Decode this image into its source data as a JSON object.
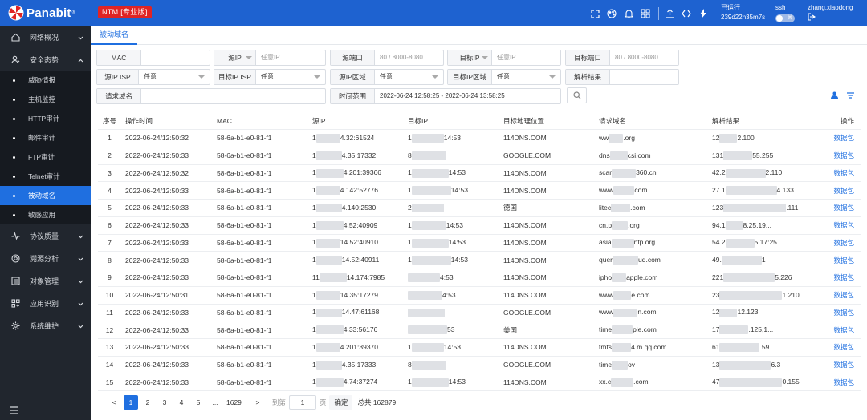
{
  "header": {
    "brand": "Panabit",
    "brand_reg": "®",
    "product_tag": "NTM [专业版]",
    "uptime_label": "已运行",
    "uptime_value": "239d22h35m7s",
    "ssh_label": "ssh",
    "ssh_toggle": "关",
    "username": "zhang.xiaodong",
    "icons": [
      "fullscreen-icon",
      "theme-icon",
      "bell-icon",
      "grid-icon",
      "upload-icon",
      "code-icon",
      "lightning-icon",
      "logout-icon"
    ]
  },
  "sidebar": {
    "items": [
      {
        "label": "网络概况",
        "icon": "home-icon",
        "expanded": false
      },
      {
        "label": "安全态势",
        "icon": "user-shield-icon",
        "expanded": true
      }
    ],
    "sub_items": [
      {
        "label": "威胁情报",
        "active": false
      },
      {
        "label": "主机监控",
        "active": false
      },
      {
        "label": "HTTP审计",
        "active": false
      },
      {
        "label": "邮件审计",
        "active": false
      },
      {
        "label": "FTP审计",
        "active": false
      },
      {
        "label": "Telnet审计",
        "active": false
      },
      {
        "label": "被动域名",
        "active": true
      },
      {
        "label": "敏感应用",
        "active": false
      }
    ],
    "items_after": [
      {
        "label": "协议质量",
        "icon": "pulse-icon"
      },
      {
        "label": "溯源分析",
        "icon": "radar-icon"
      },
      {
        "label": "对象管理",
        "icon": "list-icon"
      },
      {
        "label": "应用识别",
        "icon": "apps-icon"
      },
      {
        "label": "系统维护",
        "icon": "gear-icon"
      }
    ]
  },
  "tab": {
    "label": "被动域名"
  },
  "filters": {
    "mac": {
      "label": "MAC",
      "value": ""
    },
    "src_ip_type": {
      "label": "源IP",
      "placeholder": "任意IP"
    },
    "src_port": {
      "label": "源端口",
      "placeholder": "80 / 8000-8080"
    },
    "dst_ip_type": {
      "label": "目标IP",
      "placeholder": "任意IP"
    },
    "dst_port": {
      "label": "目标端口",
      "placeholder": "80 / 8000-8080"
    },
    "src_isp": {
      "label": "源IP ISP",
      "value": "任意"
    },
    "dst_isp": {
      "label": "目标IP ISP",
      "value": "任意"
    },
    "src_region": {
      "label": "源IP区域",
      "value": "任意"
    },
    "dst_region": {
      "label": "目标IP区域",
      "value": "任意"
    },
    "resolve_result": {
      "label": "解析结果",
      "value": ""
    },
    "domain": {
      "label": "请求域名",
      "value": ""
    },
    "time_range": {
      "label": "时间范围",
      "value": "2022-06-24 12:58:25 - 2022-06-24 13:58:25"
    }
  },
  "table": {
    "columns": [
      "序号",
      "操作时间",
      "MAC",
      "源IP",
      "目标IP",
      "目标地理位置",
      "请求域名",
      "解析结果",
      "操作"
    ],
    "rows": [
      {
        "no": "1",
        "time": "2022-06-24/12:50:32",
        "mac": "58-6a-b1-e0-81-f1",
        "src_a": "1",
        "src_b": "4.32:61524",
        "dst_a": "1",
        "dst_b": "14:53",
        "geo": "114DNS.COM",
        "dom_a": "ww",
        "dom_b": ".org",
        "res_a": "12",
        "res_b": "2.100",
        "op": "数据包"
      },
      {
        "no": "2",
        "time": "2022-06-24/12:50:33",
        "mac": "58-6a-b1-e0-81-f1",
        "src_a": "1",
        "src_b": "4.35:17332",
        "dst_a": "8",
        "dst_b": "",
        "geo": "GOOGLE.COM",
        "dom_a": "dns",
        "dom_b": "csi.com",
        "res_a": "131",
        "res_b": "55.255",
        "op": "数据包"
      },
      {
        "no": "3",
        "time": "2022-06-24/12:50:32",
        "mac": "58-6a-b1-e0-81-f1",
        "src_a": "1",
        "src_b": "4.201:39366",
        "dst_a": "1",
        "dst_b": "14:53",
        "geo": "114DNS.COM",
        "dom_a": "scar",
        "dom_b": "360.cn",
        "res_a": "42.2",
        "res_b": "2.110",
        "op": "数据包"
      },
      {
        "no": "4",
        "time": "2022-06-24/12:50:33",
        "mac": "58-6a-b1-e0-81-f1",
        "src_a": "1",
        "src_b": "4.142:52776",
        "dst_a": "1",
        "dst_b": "14:53",
        "geo": "114DNS.COM",
        "dom_a": "www",
        "dom_b": "com",
        "res_a": "27.1",
        "res_b": "4.133",
        "op": "数据包"
      },
      {
        "no": "5",
        "time": "2022-06-24/12:50:33",
        "mac": "58-6a-b1-e0-81-f1",
        "src_a": "1",
        "src_b": "4.140:2530",
        "dst_a": "2",
        "dst_b": "",
        "geo": "德国",
        "dom_a": "litec",
        "dom_b": ".com",
        "res_a": "123",
        "res_b": ".111",
        "op": "数据包"
      },
      {
        "no": "6",
        "time": "2022-06-24/12:50:33",
        "mac": "58-6a-b1-e0-81-f1",
        "src_a": "1",
        "src_b": "4.52:40909",
        "dst_a": "1",
        "dst_b": "14:53",
        "geo": "114DNS.COM",
        "dom_a": "cn.p",
        "dom_b": ".org",
        "res_a": "94.1",
        "res_b": "8.25,19...",
        "op": "数据包"
      },
      {
        "no": "7",
        "time": "2022-06-24/12:50:33",
        "mac": "58-6a-b1-e0-81-f1",
        "src_a": "1",
        "src_b": "14.52:40910",
        "dst_a": "1",
        "dst_b": "14:53",
        "geo": "114DNS.COM",
        "dom_a": "asia",
        "dom_b": "ntp.org",
        "res_a": "54.2",
        "res_b": "5,17:25...",
        "op": "数据包"
      },
      {
        "no": "8",
        "time": "2022-06-24/12:50:33",
        "mac": "58-6a-b1-e0-81-f1",
        "src_a": "1",
        "src_b": "14.52:40911",
        "dst_a": "1",
        "dst_b": "14:53",
        "geo": "114DNS.COM",
        "dom_a": "quer",
        "dom_b": "ud.com",
        "res_a": "49.",
        "res_b": "1",
        "op": "数据包"
      },
      {
        "no": "9",
        "time": "2022-06-24/12:50:33",
        "mac": "58-6a-b1-e0-81-f1",
        "src_a": "11",
        "src_b": "14.174:7985",
        "dst_a": "",
        "dst_b": "4:53",
        "geo": "114DNS.COM",
        "dom_a": "ipho",
        "dom_b": "apple.com",
        "res_a": "221",
        "res_b": "5.226",
        "op": "数据包"
      },
      {
        "no": "10",
        "time": "2022-06-24/12:50:31",
        "mac": "58-6a-b1-e0-81-f1",
        "src_a": "1",
        "src_b": "14.35:17279",
        "dst_a": "",
        "dst_b": "4:53",
        "geo": "114DNS.COM",
        "dom_a": "www",
        "dom_b": "e.com",
        "res_a": "23",
        "res_b": "1.210",
        "op": "数据包"
      },
      {
        "no": "11",
        "time": "2022-06-24/12:50:33",
        "mac": "58-6a-b1-e0-81-f1",
        "src_a": "1",
        "src_b": "14.47:61168",
        "dst_a": "",
        "dst_b": "",
        "geo": "GOOGLE.COM",
        "dom_a": "www",
        "dom_b": "n.com",
        "res_a": "12",
        "res_b": "12.123",
        "op": "数据包"
      },
      {
        "no": "12",
        "time": "2022-06-24/12:50:33",
        "mac": "58-6a-b1-e0-81-f1",
        "src_a": "1",
        "src_b": "4.33:56176",
        "dst_a": "",
        "dst_b": "53",
        "geo": "美国",
        "dom_a": "time",
        "dom_b": "ple.com",
        "res_a": "17",
        "res_b": ".125,1...",
        "op": "数据包"
      },
      {
        "no": "13",
        "time": "2022-06-24/12:50:33",
        "mac": "58-6a-b1-e0-81-f1",
        "src_a": "1",
        "src_b": "4.201:39370",
        "dst_a": "1",
        "dst_b": "14:53",
        "geo": "114DNS.COM",
        "dom_a": "tmfs",
        "dom_b": "4.m.qq.com",
        "res_a": "61",
        "res_b": ".59",
        "op": "数据包"
      },
      {
        "no": "14",
        "time": "2022-06-24/12:50:33",
        "mac": "58-6a-b1-e0-81-f1",
        "src_a": "1",
        "src_b": "4.35:17333",
        "dst_a": "8",
        "dst_b": "",
        "geo": "GOOGLE.COM",
        "dom_a": "time",
        "dom_b": "ov",
        "res_a": "13",
        "res_b": "6.3",
        "op": "数据包"
      },
      {
        "no": "15",
        "time": "2022-06-24/12:50:33",
        "mac": "58-6a-b1-e0-81-f1",
        "src_a": "1",
        "src_b": "4.74:37274",
        "dst_a": "1",
        "dst_b": "14:53",
        "geo": "114DNS.COM",
        "dom_a": "xx.c",
        "dom_b": ".com",
        "res_a": "47",
        "res_b": "0.155",
        "op": "数据包"
      }
    ]
  },
  "pagination": {
    "prev": "<",
    "pages": [
      "1",
      "2",
      "3",
      "4",
      "5"
    ],
    "active": "1",
    "ellipsis": "...",
    "last": "1629",
    "next": ">",
    "goto_label": "到第",
    "goto_value": "1",
    "page_unit": "页",
    "confirm": "确定",
    "total": "总共 162879"
  },
  "colors": {
    "primary": "#1f6fe0",
    "topbar": "#1e62d0",
    "sidebar": "#21262e",
    "tag": "#e02424"
  }
}
